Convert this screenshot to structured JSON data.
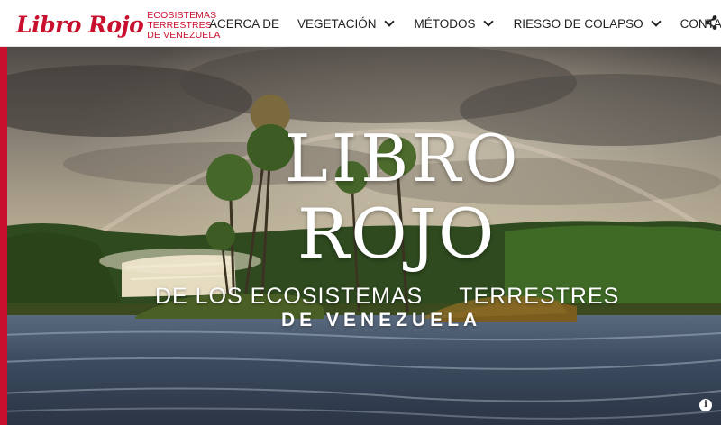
{
  "header": {
    "logo_script": "Libro Rojo",
    "logo_line1": "ECOSISTEMAS",
    "logo_line2": "TERRESTRES",
    "logo_line3": "DE VENEZUELA"
  },
  "nav": {
    "items": [
      {
        "label": "ACERCA DE",
        "has_dropdown": false
      },
      {
        "label": "VEGETACIÓN",
        "has_dropdown": true
      },
      {
        "label": "MÉTODOS",
        "has_dropdown": true
      },
      {
        "label": "RIESGO DE COLAPSO",
        "has_dropdown": true
      },
      {
        "label": "CONTACTO",
        "has_dropdown": false
      }
    ],
    "share_icon": "share-icon"
  },
  "hero": {
    "title_line1": "LIBRO",
    "title_line2": "ROJO",
    "subtitle_part1": "DE LOS ECOSISTEMAS",
    "subtitle_part2": "TERRESTRES",
    "subtitle_line2": "DE VENEZUELA",
    "info_icon": "info-icon",
    "info_glyph": "i"
  },
  "colors": {
    "brand_red": "#c8102e",
    "nav_text": "#222222",
    "title_text": "#ffffff"
  }
}
